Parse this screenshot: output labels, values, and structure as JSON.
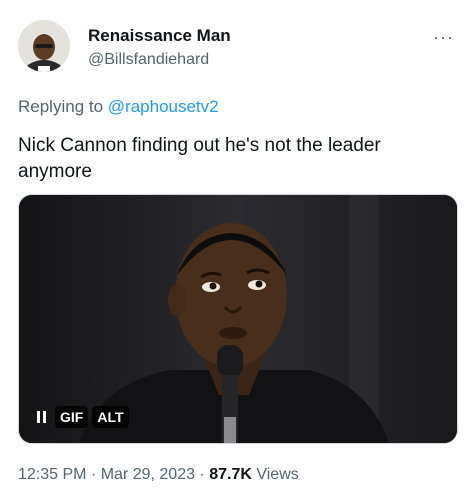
{
  "user": {
    "display_name": "Renaissance Man",
    "handle": "@Billsfandiehard",
    "more_label": "···"
  },
  "reply": {
    "prefix": "Replying to ",
    "mention": "@raphousetv2"
  },
  "tweet": {
    "text": "Nick Cannon finding out he's not the leader anymore"
  },
  "media": {
    "gif_label": "GIF",
    "alt_label": "ALT"
  },
  "meta": {
    "time": "12:35 PM",
    "separator1": " · ",
    "date": "Mar 29, 2023",
    "separator2": " · ",
    "views_count": "87.7K",
    "views_label": " Views"
  },
  "colors": {
    "link": "#1d9bf0",
    "secondary_text": "#536471",
    "primary_text": "#0f1419"
  }
}
